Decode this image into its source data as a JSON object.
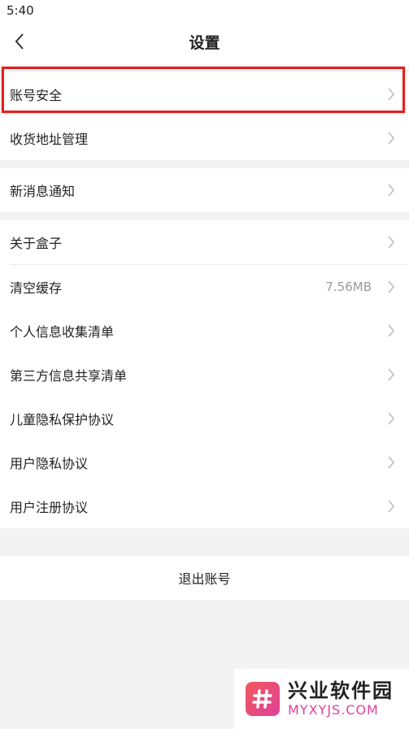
{
  "status_bar": {
    "time": "5:40"
  },
  "header": {
    "title": "设置",
    "back_icon": "chevron-left-icon"
  },
  "groups": [
    {
      "items": [
        {
          "label": "账号安全"
        },
        {
          "label": "收货地址管理"
        }
      ]
    },
    {
      "items": [
        {
          "label": "新消息通知"
        }
      ]
    },
    {
      "items": [
        {
          "label": "关于盒子"
        },
        {
          "label": "清空缓存",
          "value": "7.56MB"
        },
        {
          "label": "个人信息收集清单"
        },
        {
          "label": "第三方信息共享清单"
        },
        {
          "label": "儿童隐私保护协议"
        },
        {
          "label": "用户隐私协议"
        },
        {
          "label": "用户注册协议"
        }
      ]
    }
  ],
  "logout": {
    "label": "退出账号"
  },
  "watermark": {
    "title": "兴业软件园",
    "subtitle": "MYXYJS.COM"
  },
  "colors": {
    "highlight": "#e12020",
    "background": "#f3f3f3",
    "chevron": "#bdbdbd"
  }
}
